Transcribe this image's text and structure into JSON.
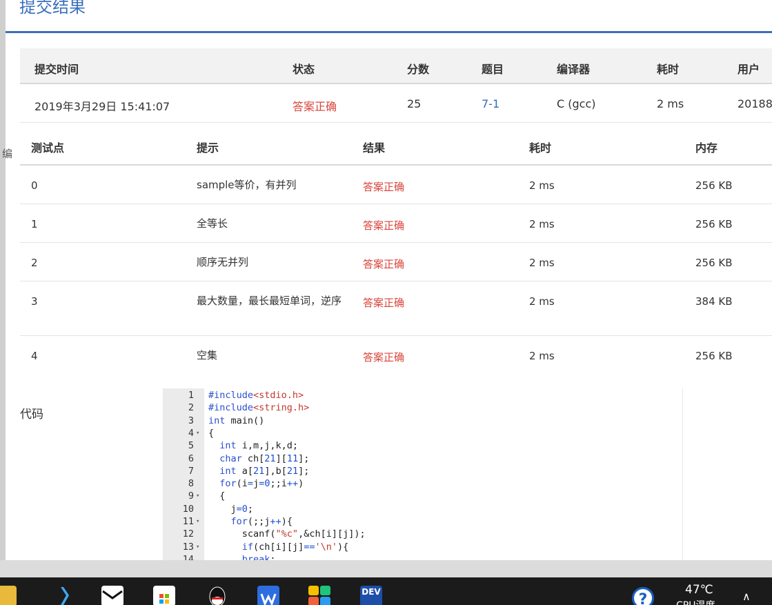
{
  "page_title": "提交结果",
  "stray_char": "编",
  "summary": {
    "headers": [
      "提交时间",
      "状态",
      "分数",
      "题目",
      "编译器",
      "耗时",
      "用户"
    ],
    "row": {
      "time": "2019年3月29日 15:41:07",
      "status": "答案正确",
      "score": "25",
      "problem": "7-1",
      "compiler": "C (gcc)",
      "elapsed": "2 ms",
      "user": "20188"
    }
  },
  "cases": {
    "headers": [
      "测试点",
      "提示",
      "结果",
      "耗时",
      "内存"
    ],
    "rows": [
      {
        "id": "0",
        "hint": "sample等价，有并列",
        "result": "答案正确",
        "time": "2 ms",
        "mem": "256 KB"
      },
      {
        "id": "1",
        "hint": "全等长",
        "result": "答案正确",
        "time": "2 ms",
        "mem": "256 KB"
      },
      {
        "id": "2",
        "hint": "顺序无并列",
        "result": "答案正确",
        "time": "2 ms",
        "mem": "256 KB"
      },
      {
        "id": "3",
        "hint": "最大数量，最长最短单词，逆序",
        "result": "答案正确",
        "time": "2 ms",
        "mem": "384 KB"
      },
      {
        "id": "4",
        "hint": "空集",
        "result": "答案正确",
        "time": "2 ms",
        "mem": "256 KB"
      }
    ]
  },
  "code_label": "代码",
  "code_lines": [
    {
      "n": "1",
      "fold": "",
      "text": "#include<stdio.h>"
    },
    {
      "n": "2",
      "fold": "",
      "text": "#include<string.h>"
    },
    {
      "n": "3",
      "fold": "",
      "text": "int main()"
    },
    {
      "n": "4",
      "fold": "▾",
      "text": "{"
    },
    {
      "n": "5",
      "fold": "",
      "text": "  int i,m,j,k,d;"
    },
    {
      "n": "6",
      "fold": "",
      "text": "  char ch[21][11];"
    },
    {
      "n": "7",
      "fold": "",
      "text": "  int a[21],b[21];"
    },
    {
      "n": "8",
      "fold": "",
      "text": "  for(i=j=0;;i++)"
    },
    {
      "n": "9",
      "fold": "▾",
      "text": "  {"
    },
    {
      "n": "10",
      "fold": "",
      "text": "    j=0;"
    },
    {
      "n": "11",
      "fold": "▾",
      "text": "    for(;;j++){"
    },
    {
      "n": "12",
      "fold": "",
      "text": "      scanf(\"%c\",&ch[i][j]);"
    },
    {
      "n": "13",
      "fold": "▾",
      "text": "      if(ch[i][j]=='\\n'){"
    },
    {
      "n": "14",
      "fold": "",
      "text": "      break;"
    }
  ],
  "taskbar": {
    "temperature": "47℃",
    "cpu_label": "CPU温度",
    "help_glyph": "?",
    "chevron": "∧",
    "icons": [
      "file-explorer-icon",
      "xmind-icon",
      "mail-icon",
      "store-icon",
      "qq-icon",
      "wps-icon",
      "app-icon",
      "dev-cpp-icon"
    ],
    "dev_label": "DEV"
  },
  "colors": {
    "accent_blue": "#3a6fbd",
    "status_green_text_red": "#d9443b",
    "problem_link": "#2f6db8"
  }
}
